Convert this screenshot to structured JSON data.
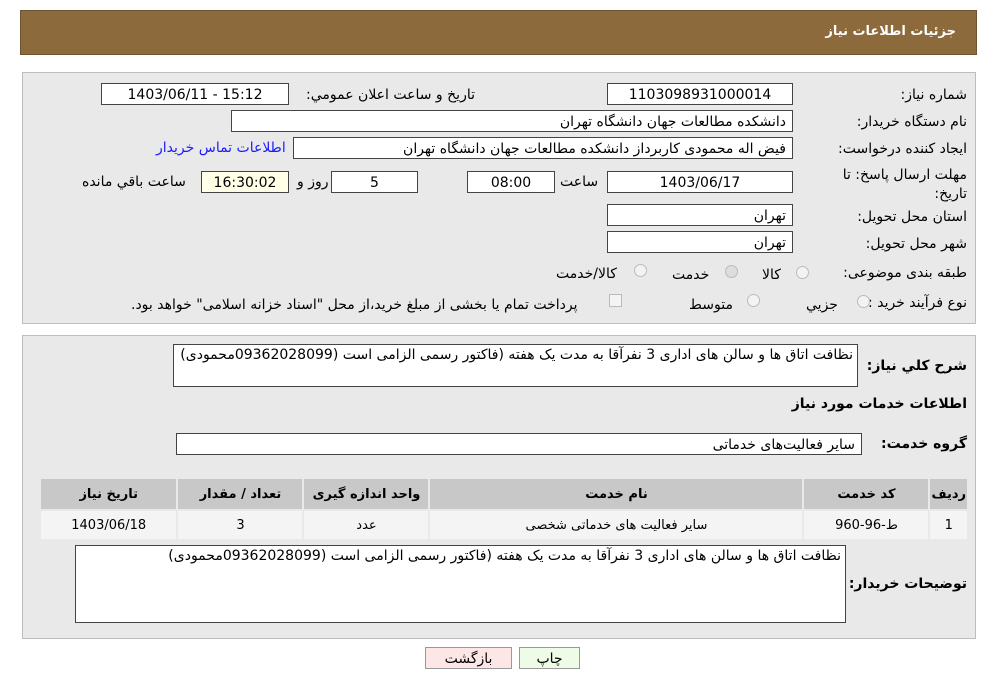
{
  "header": {
    "title": "جزئیات اطلاعات نیاز"
  },
  "form": {
    "need_number_label": "شماره نیاز:",
    "need_number": "1103098931000014",
    "announce_label": "تاریخ و ساعت اعلان عمومي:",
    "announce_value": "1403/06/11 - 15:12",
    "buyer_org_label": "نام دستگاه خریدار:",
    "buyer_org": "دانشکده مطالعات جهان دانشگاه تهران",
    "creator_label": "ایجاد کننده درخواست:",
    "creator": "فیض اله محمودی کاربرداز دانشکده مطالعات جهان دانشگاه تهران",
    "contact_link": "اطلاعات تماس خریدار",
    "deadline_label": "مهلت ارسال پاسخ: تا تاریخ:",
    "deadline_date": "1403/06/17",
    "time_label": "ساعت",
    "deadline_time": "08:00",
    "days": "5",
    "days_label": "روز و",
    "remaining": "16:30:02",
    "remaining_label": "ساعت باقي مانده",
    "province_label": "استان محل تحویل:",
    "province": "تهران",
    "city_label": "شهر محل تحویل:",
    "city": "تهران",
    "category_label": "طبقه بندی موضوعی:",
    "category_options": [
      "کالا",
      "خدمت",
      "کالا/خدمت"
    ],
    "category_selected": "خدمت",
    "process_label": "نوع فرآیند خرید :",
    "process_options": [
      "جزيي",
      "متوسط"
    ],
    "payment_note": "پرداخت تمام یا بخشی از مبلغ خرید،از محل \"اسناد خزانه اسلامی\" خواهد بود."
  },
  "details": {
    "summary_label": "شرح كلي نياز:",
    "summary": "نظافت اتاق ها و سالن های اداری 3 نفرآقا  به مدت یک هفته (فاکتور رسمی الزامی است (09362028099محمودی)",
    "services_title": "اطلاعات خدمات مورد نیاز",
    "group_label": "گروه خدمت:",
    "group": "سایر فعالیت‌های خدماتی",
    "table": {
      "headers": [
        "ردیف",
        "کد خدمت",
        "نام خدمت",
        "واحد اندازه گیری",
        "تعداد / مقدار",
        "تاریخ نیاز"
      ],
      "rows": [
        [
          "1",
          "ط-96-960",
          "سایر فعالیت های خدماتی شخصی",
          "عدد",
          "3",
          "1403/06/18"
        ]
      ]
    },
    "buyer_notes_label": "توضیحات خریدار:",
    "buyer_notes": "نظافت اتاق ها و سالن های اداری 3 نفرآقا  به مدت یک هفته (فاکتور رسمی الزامی است (09362028099محمودی)"
  },
  "buttons": {
    "print": "چاپ",
    "back": "بازگشت"
  }
}
